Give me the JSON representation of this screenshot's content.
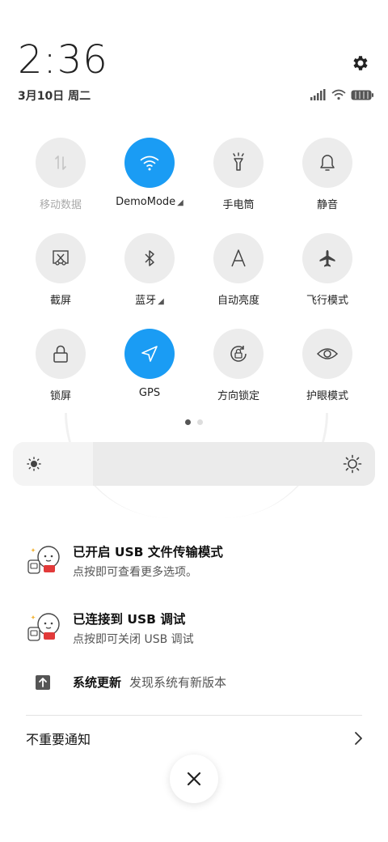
{
  "clock": {
    "time": "2:36",
    "date": "3月10日 周二"
  },
  "tiles": [
    {
      "label": "移动数据",
      "active": false,
      "disabled": true,
      "icon": "mobile-data-icon"
    },
    {
      "label": "DemoMode",
      "active": true,
      "has_more": true,
      "icon": "wifi-icon"
    },
    {
      "label": "手电筒",
      "active": false,
      "icon": "flashlight-icon"
    },
    {
      "label": "静音",
      "active": false,
      "icon": "bell-icon"
    },
    {
      "label": "截屏",
      "active": false,
      "icon": "screenshot-icon"
    },
    {
      "label": "蓝牙",
      "active": false,
      "has_more": true,
      "icon": "bluetooth-icon"
    },
    {
      "label": "自动亮度",
      "active": false,
      "icon": "auto-brightness-icon"
    },
    {
      "label": "飞行模式",
      "active": false,
      "icon": "airplane-icon"
    },
    {
      "label": "锁屏",
      "active": false,
      "icon": "lock-icon"
    },
    {
      "label": "GPS",
      "active": true,
      "icon": "location-arrow-icon"
    },
    {
      "label": "方向锁定",
      "active": false,
      "icon": "rotation-lock-icon"
    },
    {
      "label": "护眼模式",
      "active": false,
      "icon": "eye-icon"
    }
  ],
  "pager": {
    "pages": 2,
    "current": 1
  },
  "brightness": {
    "level": 0.22
  },
  "notifications": [
    {
      "title": "已开启 USB 文件传输模式",
      "text": "点按即可查看更多选项。",
      "icon": "app-avatar-icon"
    },
    {
      "title": "已连接到 USB 调试",
      "text": "点按即可关闭 USB 调试",
      "icon": "app-avatar-icon"
    }
  ],
  "system_update": {
    "title": "系统更新",
    "text": "发现系统有新版本",
    "icon": "update-arrow-icon"
  },
  "unimportant": {
    "label": "不重要通知"
  },
  "colors": {
    "accent": "#1a9cf4",
    "tile_bg": "#ececec"
  }
}
